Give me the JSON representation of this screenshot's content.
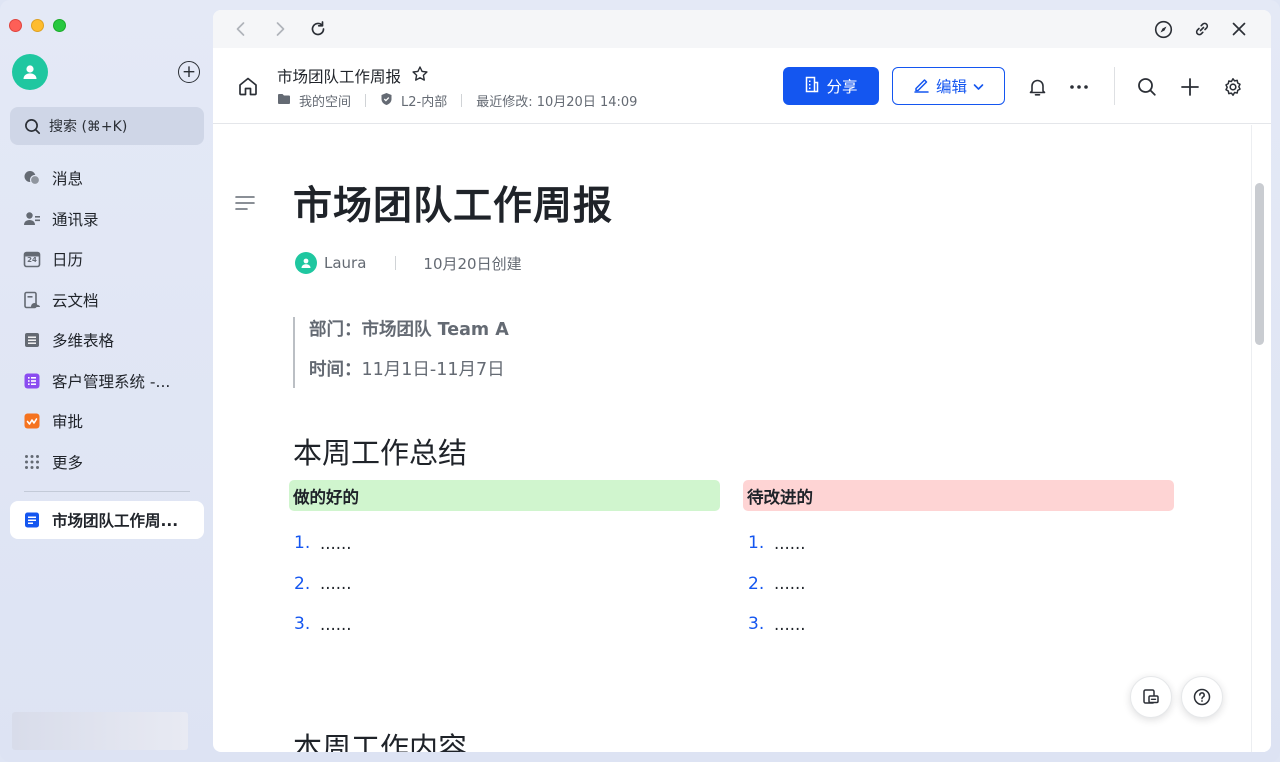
{
  "sidebar": {
    "search_placeholder": "搜索 (⌘+K)",
    "nav_items": [
      {
        "label": "消息",
        "icon": "chat-bubbles-icon"
      },
      {
        "label": "通讯录",
        "icon": "contacts-icon"
      },
      {
        "label": "日历",
        "icon": "calendar-icon"
      },
      {
        "label": "云文档",
        "icon": "cloud-docs-icon"
      },
      {
        "label": "多维表格",
        "icon": "base-table-icon"
      },
      {
        "label": "客户管理系统 -...",
        "icon": "crm-app-icon"
      },
      {
        "label": "审批",
        "icon": "approval-icon"
      },
      {
        "label": "更多",
        "icon": "more-apps-icon"
      }
    ],
    "calendar_day": "24",
    "pinned_doc": "市场团队工作周..."
  },
  "header": {
    "doc_title": "市场团队工作周报",
    "location": "我的空间",
    "security_level": "L2-内部",
    "last_modified": "最近修改: 10月20日 14:09",
    "share_label": "分享",
    "edit_label": "编辑"
  },
  "document": {
    "title": "市场团队工作周报",
    "author": "Laura",
    "created": "10月20日创建",
    "dept_label": "部门：",
    "dept_value": "市场团队 Team A",
    "time_label": "时间：",
    "time_value": "11月1日-11月7日",
    "section1": "本周工作总结",
    "good_heading": "做的好的",
    "good_items": [
      "1.",
      "2.",
      "3."
    ],
    "bad_heading": "待改进的",
    "bad_items": [
      "1.",
      "2.",
      "3."
    ],
    "item_text": "......",
    "section2": "本周工作内容"
  },
  "colors": {
    "accent": "#1456f0",
    "good_bg": "#d0f5ce",
    "bad_bg": "#fed4d4",
    "avatar": "#1fc7a0"
  }
}
